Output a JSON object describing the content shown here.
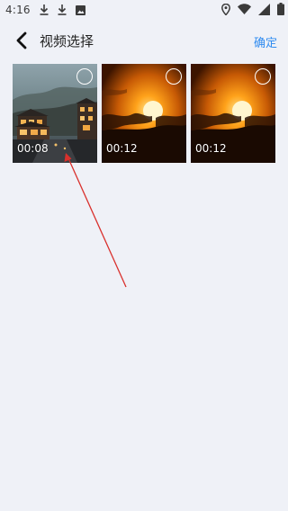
{
  "status_bar": {
    "time": "4:16",
    "left_icons": [
      "download-icon",
      "download-icon",
      "photo-icon"
    ],
    "right_icons": [
      "location-icon",
      "wifi-icon",
      "signal-icon",
      "battery-icon"
    ]
  },
  "nav": {
    "back_icon": "chevron-left-icon",
    "title": "视频选择",
    "confirm_label": "确定"
  },
  "videos": [
    {
      "duration": "00:08",
      "selected": false,
      "thumbnail": "village-dusk"
    },
    {
      "duration": "00:12",
      "selected": false,
      "thumbnail": "sunset-clouds"
    },
    {
      "duration": "00:12",
      "selected": false,
      "thumbnail": "sunset-clouds"
    }
  ],
  "colors": {
    "background": "#eff1f7",
    "accent": "#2f8bf0",
    "arrow": "#d9302c"
  }
}
